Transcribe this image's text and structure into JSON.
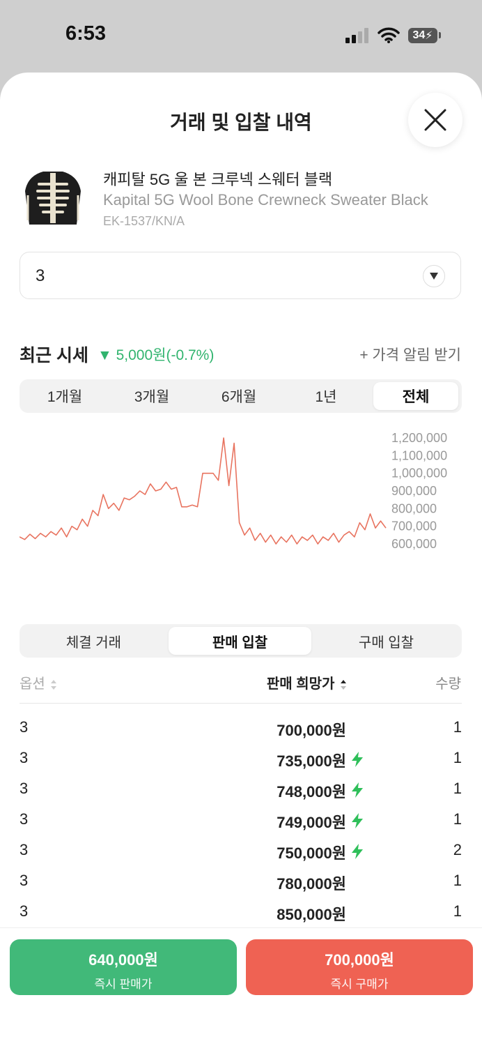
{
  "status_bar": {
    "time": "6:53",
    "battery": "34"
  },
  "sheet": {
    "title": "거래 및 입찰 내역"
  },
  "product": {
    "name_ko": "캐피탈 5G 울 본 크루넥 스웨터 블랙",
    "name_en": "Kapital 5G Wool Bone Crewneck Sweater Black",
    "code": "EK-1537/KN/A"
  },
  "size_select": {
    "value": "3"
  },
  "recent_price": {
    "label": "최근 시세",
    "change": "▼ 5,000원(-0.7%)",
    "alert_label": "+ 가격 알림 받기"
  },
  "range_tabs": [
    "1개월",
    "3개월",
    "6개월",
    "1년",
    "전체"
  ],
  "range_active": 4,
  "chart_data": {
    "type": "line",
    "y_tick_labels": [
      "1,200,000",
      "1,100,000",
      "1,000,000",
      "900,000",
      "800,000",
      "700,000",
      "600,000"
    ],
    "ylim": [
      600000,
      1200000
    ],
    "values": [
      640000,
      625000,
      655000,
      630000,
      660000,
      640000,
      670000,
      650000,
      690000,
      640000,
      700000,
      680000,
      740000,
      700000,
      790000,
      760000,
      880000,
      800000,
      830000,
      790000,
      860000,
      850000,
      870000,
      900000,
      880000,
      940000,
      900000,
      910000,
      950000,
      910000,
      920000,
      810000,
      810000,
      820000,
      810000,
      1000000,
      1000000,
      1000000,
      960000,
      1200000,
      930000,
      1170000,
      720000,
      650000,
      690000,
      620000,
      660000,
      610000,
      650000,
      600000,
      640000,
      610000,
      650000,
      600000,
      640000,
      620000,
      650000,
      600000,
      640000,
      620000,
      660000,
      610000,
      650000,
      670000,
      640000,
      720000,
      680000,
      770000,
      690000,
      730000,
      690000
    ],
    "color": "#e8735f"
  },
  "bid_tabs": [
    "체결 거래",
    "판매 입찰",
    "구매 입찰"
  ],
  "bid_active": 1,
  "table": {
    "headers": {
      "option": "옵션",
      "price": "판매 희망가",
      "qty": "수량"
    },
    "rows": [
      {
        "option": "3",
        "price": "700,000원",
        "fast": false,
        "qty": "1"
      },
      {
        "option": "3",
        "price": "735,000원",
        "fast": true,
        "qty": "1"
      },
      {
        "option": "3",
        "price": "748,000원",
        "fast": true,
        "qty": "1"
      },
      {
        "option": "3",
        "price": "749,000원",
        "fast": true,
        "qty": "1"
      },
      {
        "option": "3",
        "price": "750,000원",
        "fast": true,
        "qty": "2"
      },
      {
        "option": "3",
        "price": "780,000원",
        "fast": false,
        "qty": "1"
      },
      {
        "option": "3",
        "price": "850,000원",
        "fast": false,
        "qty": "1"
      }
    ]
  },
  "footer": {
    "sell": {
      "price": "640,000원",
      "label": "즉시 판매가",
      "color": "#41b979"
    },
    "buy": {
      "price": "700,000원",
      "label": "즉시 구매가",
      "color": "#ef6253"
    }
  },
  "colors": {
    "accent_green": "#31b46e",
    "bolt": "#2fbf5a"
  }
}
